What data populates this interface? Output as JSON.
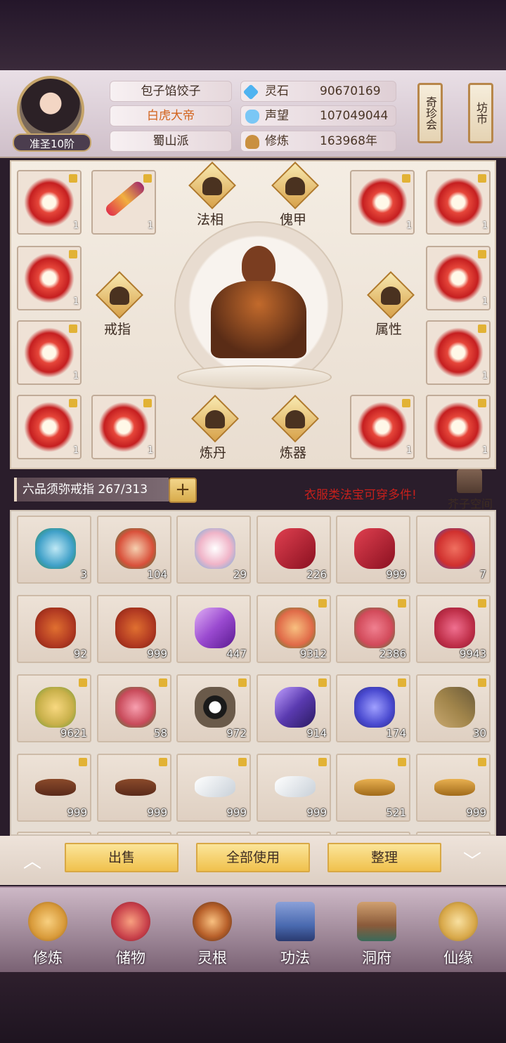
{
  "player": {
    "name": "包子馅饺子",
    "title": "白虎大帝",
    "sect": "蜀山派",
    "rank": "准圣10阶"
  },
  "stats": [
    {
      "label": "灵石",
      "value": "90670169",
      "icon": "spirit-stone-icon"
    },
    {
      "label": "声望",
      "value": "107049044",
      "icon": "reputation-icon"
    },
    {
      "label": "修炼",
      "value": "163968年",
      "icon": "cultivation-icon"
    }
  ],
  "banners": {
    "treasure": "奇珍会",
    "market": "坊市"
  },
  "equipment": {
    "slots": [
      {
        "count": "1"
      },
      {
        "count": "1"
      },
      {
        "count": "1"
      },
      {
        "count": "1"
      },
      {
        "count": "1"
      },
      {
        "count": "1"
      },
      {
        "count": "1"
      },
      {
        "count": "1"
      },
      {
        "count": "1"
      },
      {
        "count": "1"
      },
      {
        "count": "1"
      },
      {
        "count": "1"
      }
    ],
    "features": {
      "faxiang": "法相",
      "kuijia": "傀甲",
      "jiezhi": "戒指",
      "shuxing": "属性",
      "liandan": "炼丹",
      "lianqi": "炼器"
    }
  },
  "storage": {
    "ring_label": "六品须弥戒指 267/313",
    "plus": "+",
    "notice": "衣服类法宝可穿多件!",
    "space_label": "芥子空间"
  },
  "inventory": [
    {
      "count": "3",
      "color": "#3fa0c8"
    },
    {
      "count": "104",
      "color": "#d9503a"
    },
    {
      "count": "29",
      "color": "#f0b4c8"
    },
    {
      "count": "226",
      "color": "#b0202a"
    },
    {
      "count": "999",
      "color": "#b0202a"
    },
    {
      "count": "7",
      "color": "#d0302e"
    },
    {
      "count": "92",
      "color": "#b23a22"
    },
    {
      "count": "999",
      "color": "#b23a22"
    },
    {
      "count": "447",
      "color": "#9a4ad0"
    },
    {
      "count": "9312",
      "color": "#e06a48"
    },
    {
      "count": "2386",
      "color": "#d24a5a"
    },
    {
      "count": "9943",
      "color": "#c0304a"
    },
    {
      "count": "9621",
      "color": "#c8b04a"
    },
    {
      "count": "58",
      "color": "#c84a5a"
    },
    {
      "count": "972",
      "color": "#6a5a4a"
    },
    {
      "count": "914",
      "color": "#5a3ab0"
    },
    {
      "count": "174",
      "color": "#4a4ad0"
    },
    {
      "count": "30",
      "color": "#a0844a"
    },
    {
      "count": "999",
      "color": "#5a2a1a"
    },
    {
      "count": "999",
      "color": "#5a2a1a"
    },
    {
      "count": "999",
      "color": "#e8eef2"
    },
    {
      "count": "999",
      "color": "#e8eef2"
    },
    {
      "count": "521",
      "color": "#c88a2a"
    },
    {
      "count": "999",
      "color": "#c88a2a"
    }
  ],
  "actions": {
    "sell": "出售",
    "use_all": "全部使用",
    "sort": "整理",
    "up": "︿",
    "down": "﹀"
  },
  "nav": [
    {
      "label": "修炼",
      "color": "#d89a3a"
    },
    {
      "label": "储物",
      "color": "#c8404a"
    },
    {
      "label": "灵根",
      "color": "#b8602a"
    },
    {
      "label": "功法",
      "color": "#4a6ab0"
    },
    {
      "label": "洞府",
      "color": "#8a5a3a"
    },
    {
      "label": "仙缘",
      "color": "#d8a84a"
    }
  ]
}
